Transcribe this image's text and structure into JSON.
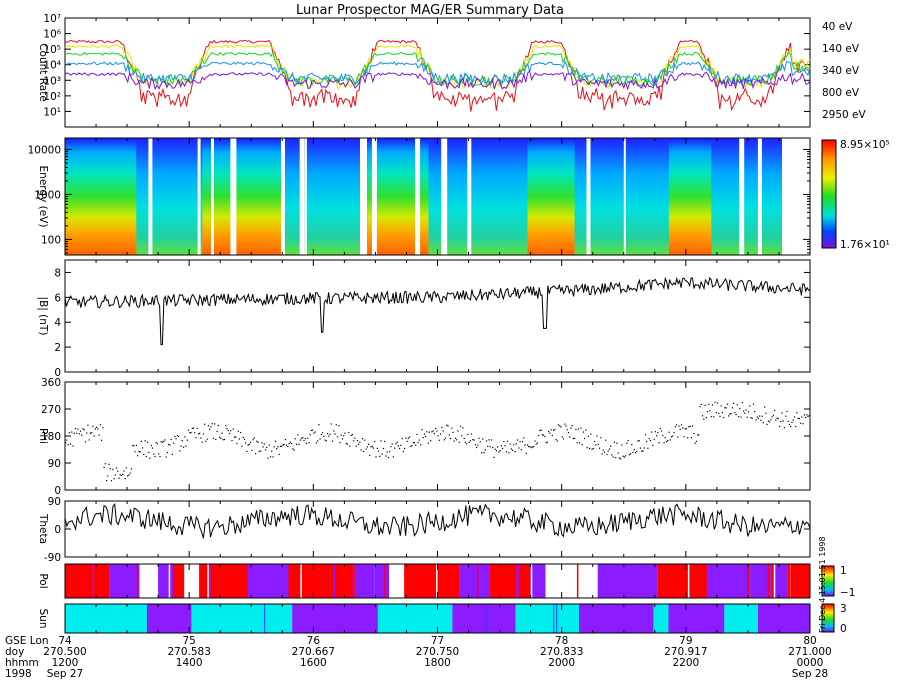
{
  "title": "Lunar Prospector MAG/ER Summary Data",
  "chart_data": [
    {
      "type": "line",
      "panel": "count_rate",
      "ylabel": "Count Rate",
      "yscale": "log",
      "ylim": [
        1,
        10000000
      ],
      "yticks": [
        "10¹",
        "10²",
        "10³",
        "10⁴",
        "10⁵",
        "10⁶",
        "10⁷"
      ],
      "series": [
        {
          "name": "40 eV",
          "color": "#e8101a",
          "day": 300000,
          "night": 200
        },
        {
          "name": "140 eV",
          "color": "#e6e600",
          "day": 150000,
          "night": 700
        },
        {
          "name": "340 eV",
          "color": "#17d12a",
          "day": 50000,
          "night": 1000
        },
        {
          "name": "800 eV",
          "color": "#1a8cff",
          "day": 12000,
          "night": 1300
        },
        {
          "name": "2950 eV",
          "color": "#7f17d9",
          "day": 2500,
          "night": 600
        }
      ]
    },
    {
      "type": "heatmap",
      "panel": "energy_spectrogram",
      "ylabel": "Energy (eV)",
      "yscale": "log",
      "ylim": [
        45,
        18000
      ],
      "yticks": [
        "10000",
        "1000",
        "100"
      ],
      "colorbar": {
        "min_label": "1.76×10¹",
        "max_label": "8.95×10⁵"
      }
    },
    {
      "type": "line",
      "panel": "b_magnitude",
      "ylabel": "|B| (nT)",
      "ylim": [
        0,
        9
      ],
      "yticks": [
        "0",
        "2",
        "4",
        "6",
        "8"
      ],
      "trend": [
        [
          0,
          5.6
        ],
        [
          0.3,
          5.9
        ],
        [
          0.5,
          6.0
        ],
        [
          0.7,
          6.6
        ],
        [
          0.83,
          7.2
        ],
        [
          1,
          6.6
        ]
      ]
    },
    {
      "type": "scatter",
      "panel": "phi",
      "ylabel": "Phi",
      "ylim": [
        0,
        360
      ],
      "yticks": [
        "0",
        "90",
        "180",
        "270",
        "360"
      ]
    },
    {
      "type": "line",
      "panel": "theta",
      "ylabel": "Theta",
      "ylim": [
        -90,
        90
      ],
      "yticks": [
        "-90",
        "0",
        "90"
      ]
    },
    {
      "type": "heatmap",
      "panel": "pol",
      "ylabel": "Pol",
      "colorbar": {
        "max_label": "1",
        "min_label": "−1"
      },
      "colors": [
        "#ff0000",
        "#8a1cff",
        "#ffffff"
      ]
    },
    {
      "type": "heatmap",
      "panel": "sun",
      "ylabel": "Sun",
      "colorbar": {
        "max_label": "3",
        "min_label": "0"
      },
      "segments": [
        [
          0.0,
          0.11,
          "#00eeee"
        ],
        [
          0.11,
          0.17,
          "#8a1cff"
        ],
        [
          0.17,
          0.305,
          "#00eeee"
        ],
        [
          0.305,
          0.42,
          "#8a1cff"
        ],
        [
          0.42,
          0.52,
          "#00eeee"
        ],
        [
          0.52,
          0.605,
          "#8a1cff"
        ],
        [
          0.605,
          0.69,
          "#00eeee"
        ],
        [
          0.69,
          0.79,
          "#8a1cff"
        ],
        [
          0.79,
          0.81,
          "#00eeee"
        ],
        [
          0.81,
          0.885,
          "#8a1cff"
        ],
        [
          0.885,
          0.93,
          "#00eeee"
        ],
        [
          0.93,
          1.0,
          "#8a1cff"
        ]
      ],
      "dividers": [
        0.268,
        0.565,
        0.656,
        0.66
      ],
      "side_annotation": "Fri Dec 4 15:01:51 1998"
    }
  ],
  "x_axis": {
    "row_labels": [
      "GSE Lon",
      "doy",
      "hhmm",
      "1998"
    ],
    "ticks": [
      {
        "lon": "74",
        "doy": "270.500",
        "hhmm": "1200",
        "date": "Sep 27"
      },
      {
        "lon": "75",
        "doy": "270.583",
        "hhmm": "1400",
        "date": ""
      },
      {
        "lon": "76",
        "doy": "270.667",
        "hhmm": "1600",
        "date": ""
      },
      {
        "lon": "77",
        "doy": "270.750",
        "hhmm": "1800",
        "date": ""
      },
      {
        "lon": "78",
        "doy": "270.833",
        "hhmm": "2000",
        "date": ""
      },
      {
        "lon": "79",
        "doy": "270.917",
        "hhmm": "2200",
        "date": ""
      },
      {
        "lon": "80",
        "doy": "271.000",
        "hhmm": "0000",
        "date": "Sep 28"
      }
    ]
  }
}
